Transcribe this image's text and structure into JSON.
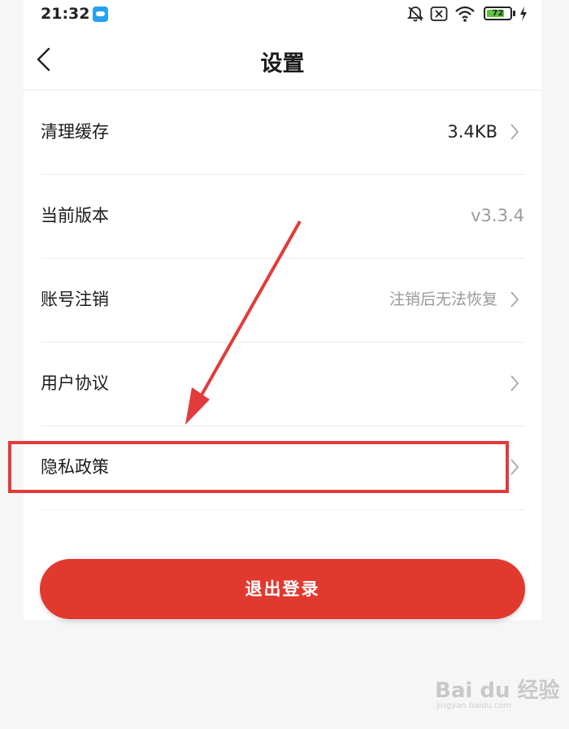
{
  "status_bar": {
    "time": "21:32",
    "battery": "72"
  },
  "header": {
    "title": "设置"
  },
  "settings": {
    "clear_cache": {
      "label": "清理缓存",
      "value": "3.4KB"
    },
    "version": {
      "label": "当前版本",
      "value": "v3.3.4"
    },
    "account_cancel": {
      "label": "账号注销",
      "value": "注销后无法恢复"
    },
    "user_agreement": {
      "label": "用户协议"
    },
    "privacy_policy": {
      "label": "隐私政策"
    }
  },
  "logout_button": {
    "label": "退出登录"
  },
  "watermark": {
    "text": "Bai du 经验",
    "sub": "jingyan.baidu.com"
  },
  "colors": {
    "accent": "#e2392f",
    "highlight": "#e23b3b",
    "battery": "#5cc63a"
  }
}
